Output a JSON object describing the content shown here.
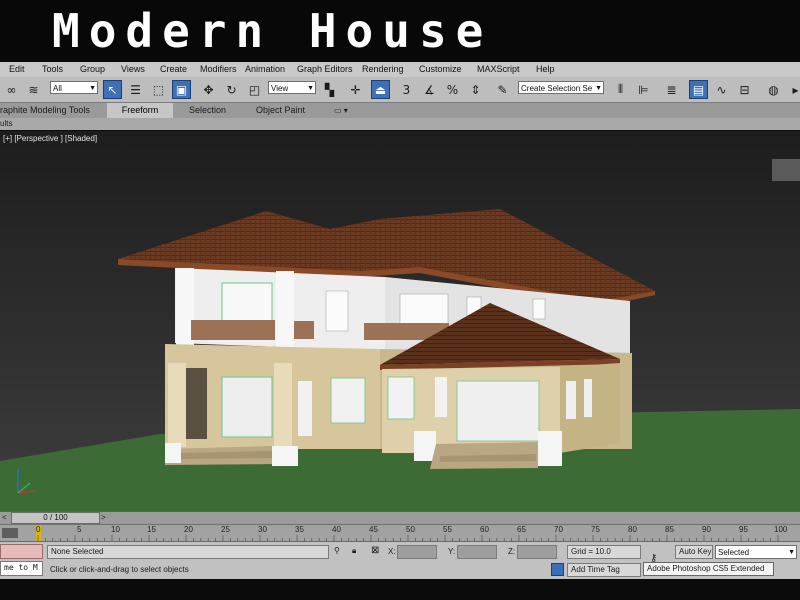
{
  "banner": {
    "title": "Modern House"
  },
  "menu": [
    "Edit",
    "Tools",
    "Group",
    "Views",
    "Create",
    "Modifiers",
    "Animation",
    "Graph Editors",
    "Rendering",
    "Customize",
    "MAXScript",
    "Help"
  ],
  "toolbar": {
    "filter_value": "All",
    "refcoord_value": "View",
    "selection_set_placeholder": "Create Selection Se",
    "snap_angle_label": "3"
  },
  "ribbon": {
    "tabs": [
      "raphite Modeling Tools",
      "Freeform",
      "Selection",
      "Object Paint"
    ],
    "active_tab": "Freeform",
    "options_glyph": "▭ ▾",
    "sub_label": "ults"
  },
  "viewport": {
    "label": "[+] [Perspective ] [Shaded]",
    "colors": {
      "bg_top": "#1f1f1f",
      "bg_bottom": "#3b3b3b",
      "grass": "#3d6b36",
      "roof": "#6b3a22",
      "wall_lower": "#d6c79e",
      "wall_upper": "#f2f2f2"
    }
  },
  "timeline": {
    "frame_indicator": "0 / 100",
    "prev_glyph": "<",
    "next_glyph": ">",
    "ticks": [
      "0",
      "5",
      "10",
      "15",
      "20",
      "25",
      "30",
      "35",
      "40",
      "45",
      "50",
      "55",
      "60",
      "65",
      "70",
      "75",
      "80",
      "85",
      "90",
      "95",
      "100"
    ]
  },
  "status": {
    "script_listener": "me to M",
    "selection": "None Selected",
    "prompt": "Click or click-and-drag to select objects",
    "x_label": "X:",
    "y_label": "Y:",
    "z_label": "Z:",
    "grid": "Grid = 10.0",
    "add_time_tag": "Add Time Tag",
    "auto_key": "Auto Key",
    "key_filter": "Selected",
    "tooltip": "Adobe Photoshop CS5 Extended"
  }
}
